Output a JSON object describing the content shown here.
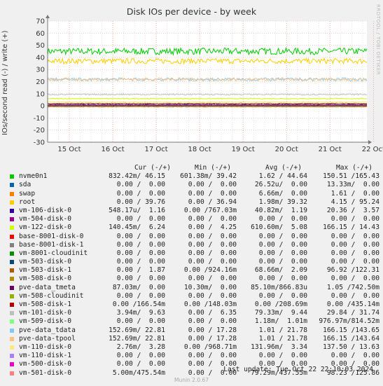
{
  "title": "Disk IOs per device - by week",
  "side_label": "RRDTOOL / TOBI OETIKER",
  "chart_data": {
    "type": "line",
    "ylabel": "IOs/second read (-) / write (+)",
    "ylim": [
      -30,
      70
    ],
    "yticks": [
      -30,
      -20,
      -10,
      0,
      10,
      20,
      30,
      40,
      50,
      60,
      70
    ],
    "x_labels": [
      "15 Oct",
      "16 Oct",
      "17 Oct",
      "18 Oct",
      "19 Oct",
      "20 Oct",
      "21 Oct",
      "22 Oct"
    ],
    "xlim_days": [
      0,
      7.35
    ],
    "grid": true,
    "series": [
      {
        "name": "nvme0n1",
        "color": "#00cc00",
        "write": 45,
        "read": 0
      },
      {
        "name": "sda",
        "color": "#0066b3",
        "write": 0,
        "read": 0
      },
      {
        "name": "swap",
        "color": "#ff8000",
        "write": 0,
        "read": 0
      },
      {
        "name": "root",
        "color": "#ffcc00",
        "write": 37,
        "read": 0
      },
      {
        "name": "vm-106-disk-0",
        "color": "#330099",
        "write": 1.2,
        "read": -0.05
      },
      {
        "name": "vm-504-disk-0",
        "color": "#990099",
        "write": 0,
        "read": 0
      },
      {
        "name": "vm-122-disk-0",
        "color": "#ccff00",
        "write": 6,
        "read": -0.6
      },
      {
        "name": "base-8001-disk-0",
        "color": "#ff0000",
        "write": 0,
        "read": 0
      },
      {
        "name": "base-8001-disk-1",
        "color": "#808080",
        "write": 0,
        "read": 0
      },
      {
        "name": "vm-8001-cloudinit",
        "color": "#008f00",
        "write": 0,
        "read": 0
      },
      {
        "name": "vm-503-disk-0",
        "color": "#00487d",
        "write": 0,
        "read": 0
      },
      {
        "name": "vm-503-disk-1",
        "color": "#b35a00",
        "write": 2,
        "read": -0.07
      },
      {
        "name": "vm-508-disk-0",
        "color": "#b38f00",
        "write": 0,
        "read": 0
      },
      {
        "name": "pve-data_tmeta",
        "color": "#6b006b",
        "write": 0.9,
        "read": -0.09
      },
      {
        "name": "vm-508-cloudinit",
        "color": "#8fb300",
        "write": 0,
        "read": 0
      },
      {
        "name": "vm-508-disk-1",
        "color": "#b30000",
        "write": 0.2,
        "read": -0.15
      },
      {
        "name": "vm-101-disk-0",
        "color": "#bebebe",
        "write": 9.4,
        "read": -0.08
      },
      {
        "name": "vm-509-disk-0",
        "color": "#80ff80",
        "write": 0,
        "read": 0
      },
      {
        "name": "pve-data_tdata",
        "color": "#80c9ff",
        "write": 21.8,
        "read": -1
      },
      {
        "name": "pve-data-tpool",
        "color": "#ffc080",
        "write": 21.8,
        "read": -1
      },
      {
        "name": "vm-110-disk-0",
        "color": "#ffe680",
        "write": 3.3,
        "read": -0.13
      },
      {
        "name": "vm-110-disk-1",
        "color": "#aa80ff",
        "write": 0,
        "read": 0
      },
      {
        "name": "vm-500-disk-0",
        "color": "#ee00cc",
        "write": 0,
        "read": 0
      },
      {
        "name": "vm-501-disk-0",
        "color": "#ff8080",
        "write": 0.5,
        "read": -0.08
      }
    ]
  },
  "legend": {
    "headers": [
      "Cur (-/+)",
      "Min (-/+)",
      "Avg (-/+)",
      "Max (-/+)"
    ],
    "rows": [
      {
        "name": "nvme0n1",
        "cur": "832.42m/ 46.15",
        "min": "601.38m/ 39.42",
        "avg": "1.62 / 44.64",
        "max": "150.51 /165.43"
      },
      {
        "name": "sda",
        "cur": "0.00 /  0.00",
        "min": "0.00 /  0.00",
        "avg": "26.52u/  0.00",
        "max": "13.33m/  0.00"
      },
      {
        "name": "swap",
        "cur": "0.00 /  0.00",
        "min": "0.00 /  0.00",
        "avg": "6.66m/  0.00",
        "max": "1.61 /  0.00"
      },
      {
        "name": "root",
        "cur": "0.00 / 39.76",
        "min": "0.00 / 36.94",
        "avg": "1.98m/ 39.32",
        "max": "4.15 / 95.24"
      },
      {
        "name": "vm-106-disk-0",
        "cur": "548.17u/  1.16",
        "min": "0.00 /767.03m",
        "avg": "40.82m/  1.19",
        "max": "20.36 /  3.57"
      },
      {
        "name": "vm-504-disk-0",
        "cur": "0.00 /  0.00",
        "min": "0.00 /  0.00",
        "avg": "0.00 /  0.00",
        "max": "0.00 /  0.00"
      },
      {
        "name": "vm-122-disk-0",
        "cur": "140.45m/  6.24",
        "min": "0.00 /  4.25",
        "avg": "610.60m/  5.08",
        "max": "166.15 / 14.43"
      },
      {
        "name": "base-8001-disk-0",
        "cur": "0.00 /  0.00",
        "min": "0.00 /  0.00",
        "avg": "0.00 /  0.00",
        "max": "0.00 /  0.00"
      },
      {
        "name": "base-8001-disk-1",
        "cur": "0.00 /  0.00",
        "min": "0.00 /  0.00",
        "avg": "0.00 /  0.00",
        "max": "0.00 /  0.00"
      },
      {
        "name": "vm-8001-cloudinit",
        "cur": "0.00 /  0.00",
        "min": "0.00 /  0.00",
        "avg": "0.00 /  0.00",
        "max": "0.00 /  0.00"
      },
      {
        "name": "vm-503-disk-0",
        "cur": "0.00 /  0.00",
        "min": "0.00 /  0.00",
        "avg": "0.00 /  0.00",
        "max": "0.00 /  0.00"
      },
      {
        "name": "vm-503-disk-1",
        "cur": "0.00 /  1.87",
        "min": "0.00 /924.16m",
        "avg": "68.66m/  2.09",
        "max": "96.92 /122.31"
      },
      {
        "name": "vm-508-disk-0",
        "cur": "0.00 /  0.00",
        "min": "0.00 /  0.00",
        "avg": "0.00 /  0.00",
        "max": "0.00 /  0.00"
      },
      {
        "name": "pve-data_tmeta",
        "cur": "87.03m/  0.00",
        "min": "10.30m/  0.00",
        "avg": "85.10m/866.83u",
        "max": "1.05 /742.50m"
      },
      {
        "name": "vm-508-cloudinit",
        "cur": "0.00 /  0.00",
        "min": "0.00 /  0.00",
        "avg": "0.00 /  0.00",
        "max": "0.00 /  0.00"
      },
      {
        "name": "vm-508-disk-1",
        "cur": "0.00 /166.54m",
        "min": "0.00 /148.03m",
        "avg": "0.00 /208.69m",
        "max": "0.00 /435.14m"
      },
      {
        "name": "vm-101-disk-0",
        "cur": "3.94m/  9.63",
        "min": "0.00 /  6.35",
        "avg": "79.33m/  9.44",
        "max": "29.84 / 31.74"
      },
      {
        "name": "vm-509-disk-0",
        "cur": "0.00 /  0.00",
        "min": "0.00 /  0.00",
        "avg": "1.18m/  1.01m",
        "max": "976.97m/814.52m"
      },
      {
        "name": "pve-data_tdata",
        "cur": "152.69m/ 22.81",
        "min": "0.00 / 17.28",
        "avg": "1.01 / 21.78",
        "max": "166.15 /143.65"
      },
      {
        "name": "pve-data-tpool",
        "cur": "152.69m/ 22.81",
        "min": "0.00 / 17.28",
        "avg": "1.01 / 21.78",
        "max": "166.15 /143.64"
      },
      {
        "name": "vm-110-disk-0",
        "cur": "2.76m/  3.28",
        "min": "0.00 /968.71m",
        "avg": "131.96m/  3.34",
        "max": "137.50 / 13.63"
      },
      {
        "name": "vm-110-disk-1",
        "cur": "0.00 /  0.00",
        "min": "0.00 /  0.00",
        "avg": "0.00 /  0.00",
        "max": "0.00 /  0.00"
      },
      {
        "name": "vm-500-disk-0",
        "cur": "0.00 /  0.00",
        "min": "0.00 /  0.00",
        "avg": "0.00 /  0.00",
        "max": "0.00 /  0.00"
      },
      {
        "name": "vm-501-disk-0",
        "cur": "5.00m/475.54m",
        "min": "0.00 /  0.00",
        "avg": "79.29m/437.55m",
        "max": "98.23 /125.86"
      }
    ]
  },
  "last_update": "Last update: Tue Oct 22 22:10:03 2024",
  "footer": "Munin 2.0.67"
}
